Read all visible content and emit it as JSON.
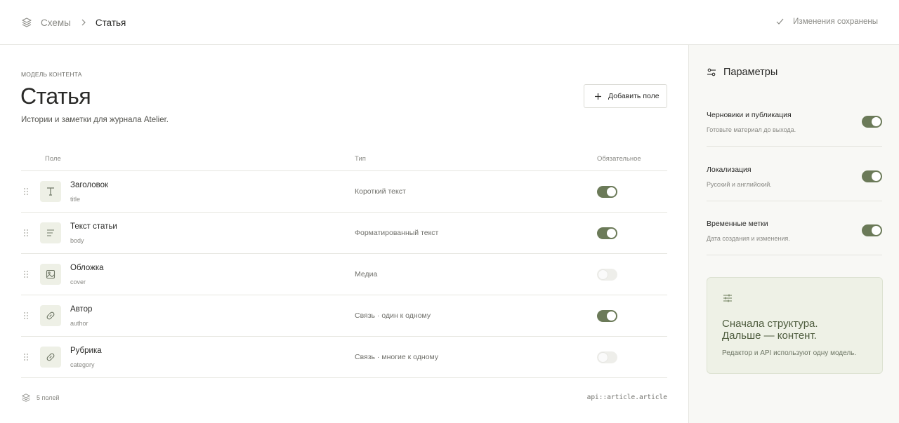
{
  "header": {
    "breadcrumb": [
      "Схемы",
      "Статья"
    ],
    "save_status": "Изменения сохранены"
  },
  "main": {
    "eyebrow": "Модель контента",
    "title": "Статья",
    "subtitle": "Истории и заметки для журнала Atelier.",
    "add_button": "Добавить поле",
    "columns": [
      "Поле",
      "Тип",
      "Обязательное"
    ],
    "fields": [
      {
        "name": "Заголовок",
        "key": "title",
        "type": "Короткий текст",
        "required": true,
        "icon": "text-type-icon"
      },
      {
        "name": "Текст статьи",
        "key": "body",
        "type": "Форматированный текст",
        "required": true,
        "icon": "paragraph-icon"
      },
      {
        "name": "Обложка",
        "key": "cover",
        "type": "Медиа",
        "required": false,
        "icon": "image-icon"
      },
      {
        "name": "Автор",
        "key": "author",
        "type": "Связь · один к одному",
        "required": true,
        "icon": "link-icon"
      },
      {
        "name": "Рубрика",
        "key": "category",
        "type": "Связь · многие к одному",
        "required": false,
        "icon": "link-icon"
      }
    ],
    "field_count": "5 полей",
    "api_id": "api::article.article"
  },
  "side": {
    "title": "Параметры",
    "settings": [
      {
        "label": "Черновики и публикация",
        "desc": "Готовьте материал до выхода.",
        "enabled": true
      },
      {
        "label": "Локализация",
        "desc": "Русский и английский.",
        "enabled": true
      },
      {
        "label": "Временные метки",
        "desc": "Дата создания и изменения.",
        "enabled": true
      }
    ],
    "promo": {
      "heading_line1": "Сначала структура.",
      "heading_line2": "Дальше — контент.",
      "desc": "Редактор и API используют одну модель."
    }
  },
  "colors": {
    "accent": "#6b7a58",
    "promo_bg": "#eef1e6",
    "icon_tile": "#eef0e6"
  }
}
